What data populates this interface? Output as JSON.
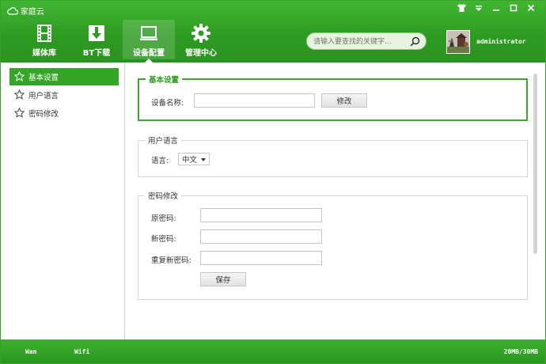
{
  "window": {
    "title": "家庭云",
    "controls": [
      "shirt-icon",
      "menu-icon",
      "minimize-icon",
      "maximize-icon",
      "close-icon"
    ]
  },
  "nav": {
    "items": [
      {
        "label": "媒体库",
        "icon": "film-icon"
      },
      {
        "label": "BT下载",
        "icon": "download-icon"
      },
      {
        "label": "设备配置",
        "icon": "monitor-icon",
        "active": true
      },
      {
        "label": "管理中心",
        "icon": "gear-icon"
      }
    ]
  },
  "search": {
    "placeholder": "请输入要查找的关键字..."
  },
  "user": {
    "name": "administrator"
  },
  "sidebar": {
    "items": [
      {
        "label": "基本设置",
        "active": true
      },
      {
        "label": "用户语言"
      },
      {
        "label": "密码修改"
      }
    ]
  },
  "basic": {
    "legend": "基本设置",
    "device_label": "设备名称:",
    "device_value": "",
    "modify_label": "修改"
  },
  "language": {
    "legend": "用户语言",
    "lang_label": "语言:",
    "lang_value": "中文"
  },
  "password": {
    "legend": "密码修改",
    "old_label": "原密码:",
    "new_label": "新密码:",
    "repeat_label": "重复新密码:",
    "save_label": "保存"
  },
  "status": {
    "wan": "Wan",
    "wifi": "Wifi",
    "storage": "20MB/30MB"
  },
  "colors": {
    "brand_green": "#2e9b22",
    "active_green": "#35a528"
  }
}
